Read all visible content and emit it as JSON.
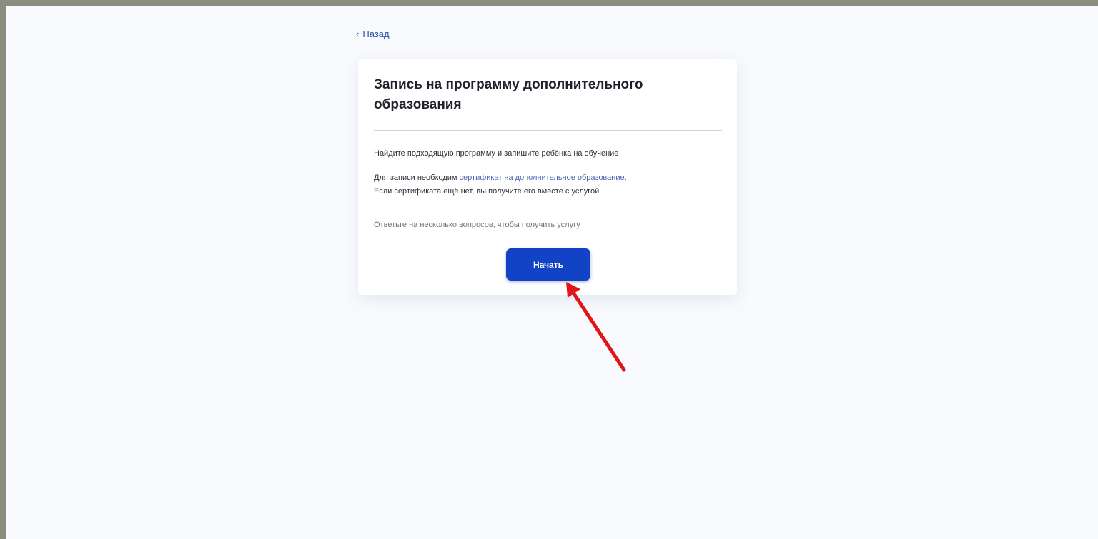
{
  "nav": {
    "back_label": "Назад"
  },
  "card": {
    "title": "Запись на программу дополнительного образования",
    "intro": "Найдите подходящую программу и запишите ребёнка на обучение",
    "cert_prefix": "Для записи необходим ",
    "cert_link": "сертификат на дополнительное образование",
    "cert_suffix": ".",
    "cert_line2": "Если сертификата ещё нет, вы получите его вместе с услугой",
    "hint": "Ответьте на несколько вопросов, чтобы получить услугу",
    "start_label": "Начать"
  },
  "colors": {
    "primary": "#1243c6",
    "link": "#4b64b2",
    "annotation_arrow": "#e0161b"
  },
  "icons": {
    "back": "chevron-left-icon",
    "annotation": "red-arrow-icon"
  }
}
